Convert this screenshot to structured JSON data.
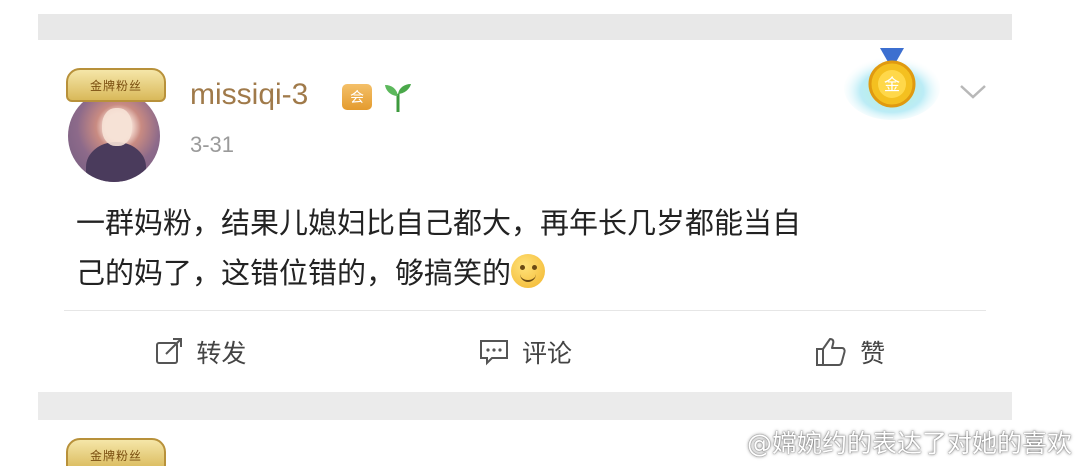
{
  "post": {
    "badge_text": "金牌粉丝",
    "username": "missiqi-3",
    "vip_icon_text": "会",
    "date": "3-31",
    "content_line1": "一群妈粉，结果儿媳妇比自己都大，再年长几岁都能当自",
    "content_line2": "己的妈了，这错位错的，够搞笑的",
    "medal_text": "金"
  },
  "actions": {
    "repost_label": "转发",
    "comment_label": "评论",
    "like_label": "赞"
  },
  "next_post": {
    "badge_text": "金牌粉丝"
  },
  "watermark": {
    "text": "@嫦婉约的表达了对她的喜欢"
  },
  "colors": {
    "username": "#a07a4a",
    "separator_gray": "#ebebeb",
    "text": "#222222"
  },
  "icons": [
    "avatar",
    "vip-icon",
    "sprout-icon",
    "gold-medal-icon",
    "chevron-down-icon",
    "smile-emoji-icon",
    "repost-icon",
    "comment-icon",
    "like-icon",
    "weibo-logo-icon"
  ]
}
